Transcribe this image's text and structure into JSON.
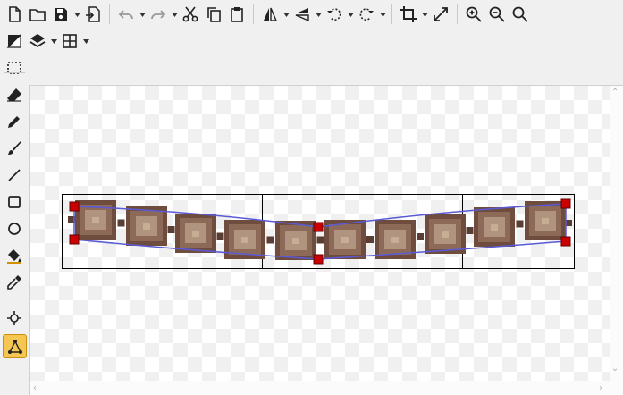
{
  "toolbar": {
    "row1": [
      {
        "id": "new",
        "icon": "new-file-icon"
      },
      {
        "id": "open",
        "icon": "folder-open-icon"
      },
      {
        "id": "save",
        "icon": "save-icon",
        "dropdown": true
      },
      {
        "id": "export",
        "icon": "export-file-icon",
        "sep_after": true
      },
      {
        "id": "undo",
        "icon": "undo-icon",
        "dropdown": true,
        "disabled": true
      },
      {
        "id": "redo",
        "icon": "redo-icon",
        "dropdown": true,
        "disabled": true
      },
      {
        "id": "cut",
        "icon": "scissors-icon"
      },
      {
        "id": "copy",
        "icon": "copy-icon"
      },
      {
        "id": "paste",
        "icon": "paste-icon",
        "sep_after": true
      },
      {
        "id": "flip-h",
        "icon": "flip-horizontal-icon",
        "dropdown": true
      },
      {
        "id": "flip-v",
        "icon": "flip-vertical-icon",
        "dropdown": true
      },
      {
        "id": "rotate-ccw",
        "icon": "rotate-ccw-icon",
        "dropdown": true
      },
      {
        "id": "rotate-cw",
        "icon": "rotate-cw-icon",
        "dropdown": true,
        "sep_after": true
      },
      {
        "id": "crop",
        "icon": "crop-icon",
        "dropdown": true
      },
      {
        "id": "resize",
        "icon": "resize-icon",
        "sep_after": true
      },
      {
        "id": "zoom-in",
        "icon": "zoom-in-icon"
      },
      {
        "id": "zoom-out",
        "icon": "zoom-out-icon"
      },
      {
        "id": "zoom-reset",
        "icon": "zoom-reset-icon"
      }
    ],
    "row2": [
      {
        "id": "color-swap",
        "icon": "color-swap-icon"
      },
      {
        "id": "layers",
        "icon": "layers-icon",
        "dropdown": true
      },
      {
        "id": "grid",
        "icon": "grid-icon",
        "dropdown": true
      }
    ]
  },
  "tools": [
    {
      "id": "select",
      "icon": "selection-rect-icon"
    },
    {
      "id": "eraser",
      "icon": "eraser-icon"
    },
    {
      "id": "pencil",
      "icon": "pencil-icon"
    },
    {
      "id": "brush",
      "icon": "brush-icon"
    },
    {
      "id": "line",
      "icon": "line-icon"
    },
    {
      "id": "rectangle",
      "icon": "rectangle-icon"
    },
    {
      "id": "ellipse",
      "icon": "ellipse-icon"
    },
    {
      "id": "fill",
      "icon": "paint-bucket-icon"
    },
    {
      "id": "color-picker",
      "icon": "eyedropper-icon"
    },
    {
      "id": "crosshair",
      "icon": "crosshair-icon"
    },
    {
      "id": "warp",
      "icon": "warp-icon",
      "active": true
    }
  ],
  "colors": {
    "accent": "#f6c653",
    "accent_border": "#c98f11",
    "curve": "#5a5ad8",
    "handle": "#cc0000",
    "tile_dark": "#6e4c3e",
    "tile_mid": "#8c6a57",
    "tile_light": "#b09480",
    "tile_core": "#c8ad95"
  }
}
